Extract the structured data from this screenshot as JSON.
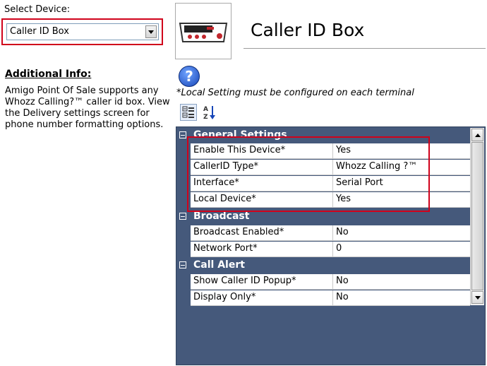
{
  "device_selector": {
    "label": "Select Device:",
    "selected": "Caller ID Box"
  },
  "additional_info": {
    "title": "Additional Info:",
    "text": "Amigo Point Of Sale supports any Whozz Calling?™ caller id box. View the Delivery settings screen for phone number formatting options."
  },
  "device_panel": {
    "title": "Caller ID Box",
    "image_icon": "caller-id-box-device-image"
  },
  "note": "*Local Setting must be configured on each terminal",
  "toolbar": {
    "categorized_icon": "categorized-view-icon",
    "alphabetical_icon": "alphabetical-sort-icon"
  },
  "property_grid": {
    "categories": [
      {
        "name": "General Settings",
        "properties": [
          {
            "name": "Enable This Device*",
            "value": "Yes"
          },
          {
            "name": "CallerID Type*",
            "value": "Whozz Calling ?™"
          },
          {
            "name": "Interface*",
            "value": "Serial Port"
          },
          {
            "name": "Local Device*",
            "value": "Yes"
          }
        ]
      },
      {
        "name": "Broadcast",
        "properties": [
          {
            "name": "Broadcast Enabled*",
            "value": "No"
          },
          {
            "name": "Network Port*",
            "value": "0"
          }
        ]
      },
      {
        "name": "Call Alert",
        "properties": [
          {
            "name": "Show Caller ID Popup*",
            "value": "No"
          },
          {
            "name": "Display Only*",
            "value": "No"
          }
        ]
      }
    ]
  },
  "colors": {
    "highlight": "#d0021b",
    "category_background": "#45597b"
  }
}
